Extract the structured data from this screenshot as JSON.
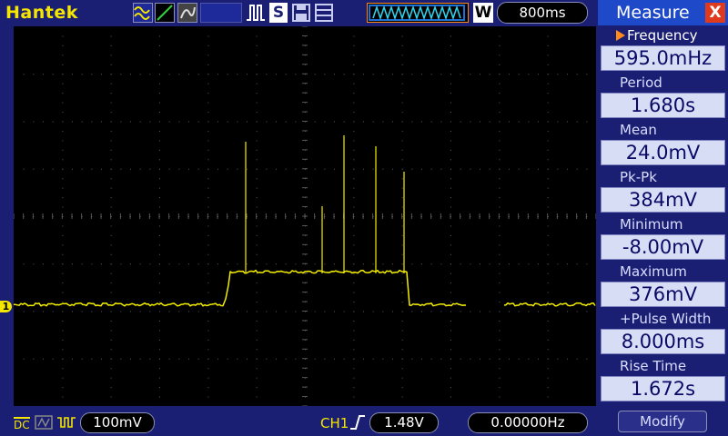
{
  "header": {
    "brand": "Hantek",
    "run_state": "S",
    "timebase": "800ms",
    "trigger_mode": "W"
  },
  "scope": {
    "channel_marker": "1",
    "colors": {
      "trace": "#f4ee00",
      "grid": "#5a5a5a",
      "background": "#000000"
    }
  },
  "bottom": {
    "coupling": "DC",
    "ch1_scale": "100mV",
    "trigger_source": "CH1",
    "trigger_level": "1.48V",
    "frequency": "0.00000Hz"
  },
  "measure": {
    "title": "Measure",
    "close_label": "X",
    "items": [
      {
        "label": "Frequency",
        "value": "595.0mHz"
      },
      {
        "label": "Period",
        "value": "1.680s"
      },
      {
        "label": "Mean",
        "value": "24.0mV"
      },
      {
        "label": "Pk-Pk",
        "value": "384mV"
      },
      {
        "label": "Minimum",
        "value": "-8.00mV"
      },
      {
        "label": "Maximum",
        "value": "376mV"
      },
      {
        "label": "+Pulse Width",
        "value": "8.000ms"
      },
      {
        "label": "Rise Time",
        "value": "1.672s"
      }
    ],
    "modify_label": "Modify"
  }
}
